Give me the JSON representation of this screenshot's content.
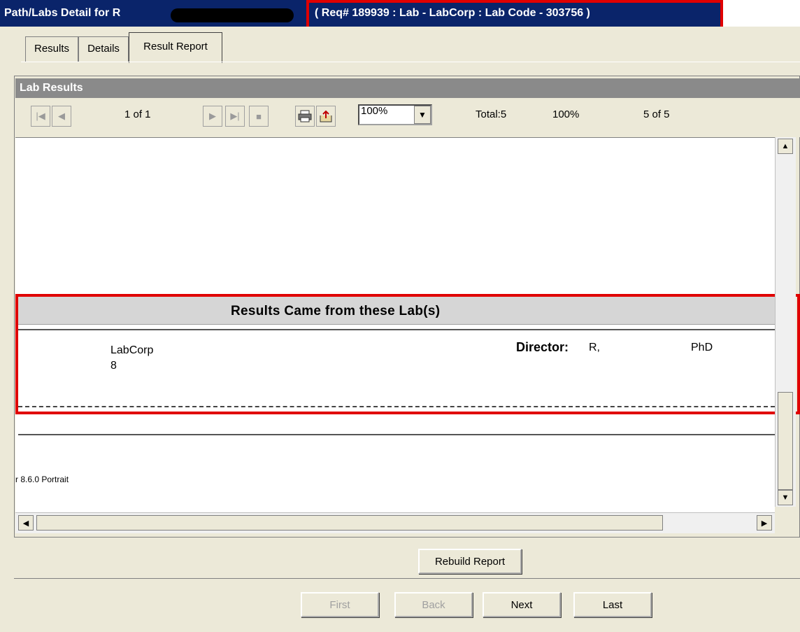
{
  "window": {
    "title": "Path/Labs Detail for R",
    "requisition": "( Req# 189939 : Lab - LabCorp : Lab Code - 303756 )"
  },
  "tabs": [
    {
      "label": "Results",
      "active": false
    },
    {
      "label": "Details",
      "active": false
    },
    {
      "label": "Result Report",
      "active": true
    }
  ],
  "panel": {
    "header": "Lab Results"
  },
  "toolbar": {
    "page_indicator": "1 of 1",
    "zoom": "100%",
    "total": "Total:5",
    "percent": "100%",
    "count": "5 of 5"
  },
  "report": {
    "section_title": "Results Came from these Lab(s)",
    "lab_name": "LabCorp",
    "lab_address_prefix": "8",
    "director_label": "Director:",
    "director_name_prefix": "R,",
    "director_suffix": "PhD",
    "footer_text": "r 8.6.0 Portrait"
  },
  "buttons": {
    "rebuild": "Rebuild Report",
    "first": "First",
    "back": "Back",
    "next": "Next",
    "last": "Last"
  },
  "colors": {
    "titlebar": "#0a246a",
    "highlight": "#e00000",
    "dialog": "#ece9d8"
  }
}
